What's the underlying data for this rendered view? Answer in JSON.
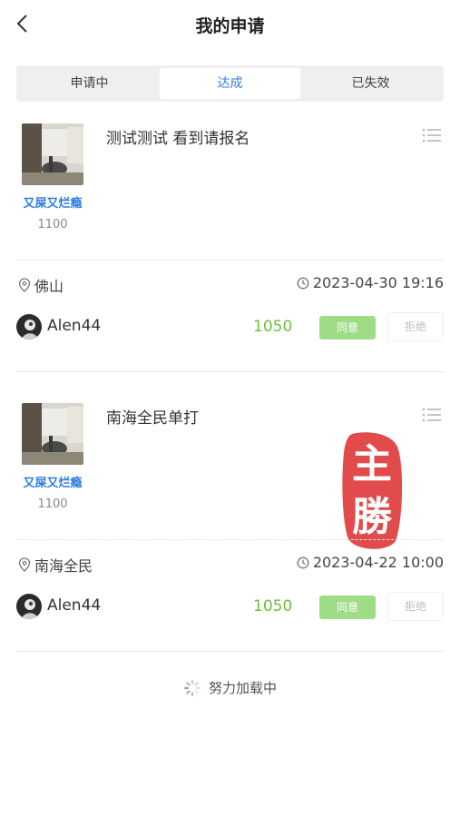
{
  "header": {
    "title": "我的申请",
    "back_icon": "chevron-left-icon"
  },
  "tabs": [
    {
      "label": "申请中",
      "active": false
    },
    {
      "label": "达成",
      "active": true
    },
    {
      "label": "已失效",
      "active": false
    }
  ],
  "cards": [
    {
      "owner": {
        "name": "又屎又烂瘾",
        "score": "1100"
      },
      "title": "测试测试 看到请报名",
      "location": "佛山",
      "time": "2023-04-30 19:16",
      "applicant": {
        "name": "Alen44",
        "amount": "1050"
      },
      "agree_label": "同意",
      "reject_label": "拒绝",
      "stamp": false
    },
    {
      "owner": {
        "name": "又屎又烂瘾",
        "score": "1100"
      },
      "title": "南海全民单打",
      "location": "南海全民",
      "time": "2023-04-22 10:00",
      "applicant": {
        "name": "Alen44",
        "amount": "1050"
      },
      "agree_label": "同意",
      "reject_label": "拒绝",
      "stamp": true,
      "stamp_text": "主勝"
    }
  ],
  "loading_text": "努力加载中",
  "colors": {
    "accent": "#2f7de1",
    "amount": "#6dbf3e",
    "agree_bg": "#9fdc86",
    "stamp": "#e03b3b"
  }
}
